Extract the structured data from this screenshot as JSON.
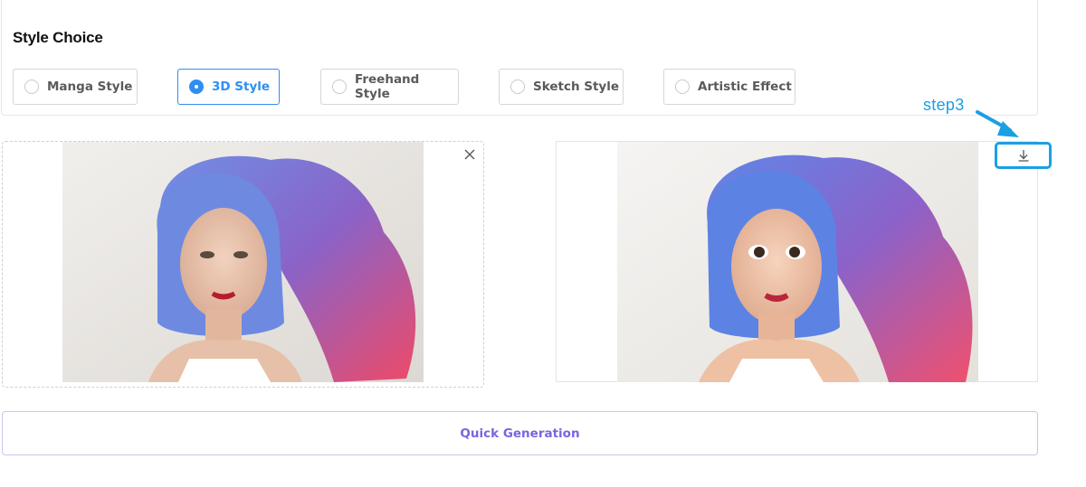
{
  "style_choice": {
    "title": "Style Choice",
    "options": [
      {
        "label": "Manga Style",
        "selected": false
      },
      {
        "label": "3D Style",
        "selected": true
      },
      {
        "label": "Freehand Style",
        "selected": false
      },
      {
        "label": "Sketch Style",
        "selected": false
      },
      {
        "label": "Artistic Effect",
        "selected": false
      }
    ]
  },
  "annotation": {
    "step_label": "step3",
    "color": "#1b9fe3"
  },
  "icons": {
    "close": "close-icon",
    "download": "download-icon",
    "radio": "radio-icon"
  },
  "actions": {
    "generate_label": "Quick Generation"
  },
  "colors": {
    "accent_blue": "#2f8ef2",
    "generate_purple": "#7a64de"
  }
}
